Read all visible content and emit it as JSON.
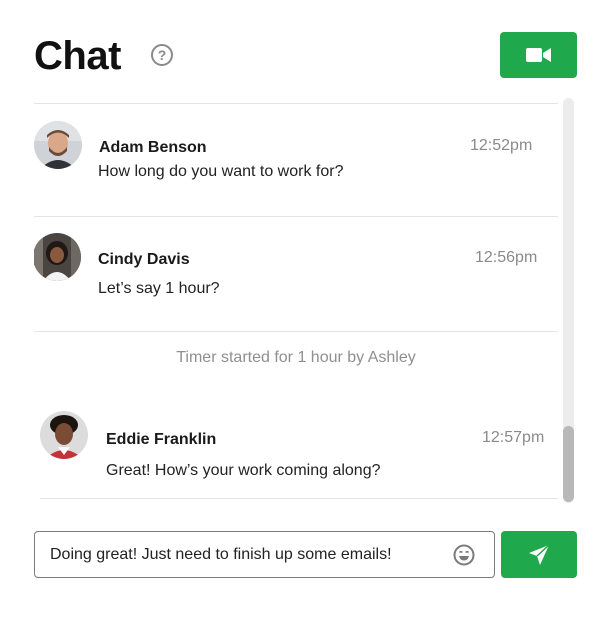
{
  "header": {
    "title": "Chat",
    "help_icon": "?"
  },
  "actions": {
    "video_button": "video-camera-icon",
    "send_button": "send-icon"
  },
  "messages": [
    {
      "sender": "Adam Benson",
      "time": "12:52pm",
      "text": "How long do you want to work for?"
    },
    {
      "sender": "Cindy Davis",
      "time": "12:56pm",
      "text": "Let’s say 1 hour?"
    },
    {
      "sender": "Eddie Franklin",
      "time": "12:57pm",
      "text": "Great! How’s your work coming along?"
    }
  ],
  "system_message": "Timer started for 1 hour by Ashley",
  "composer": {
    "value": "Doing great! Just need to finish up some emails!"
  },
  "colors": {
    "accent": "#1fa84c",
    "muted": "#8a8a8a"
  }
}
